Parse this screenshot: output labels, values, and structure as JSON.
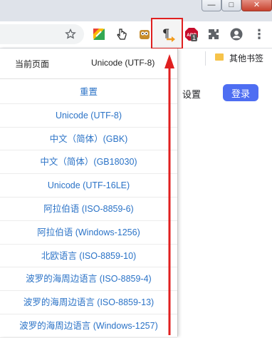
{
  "window": {
    "min_glyph": "—",
    "max_glyph": "□",
    "close_glyph": "✕"
  },
  "toolbar": {
    "star_icon": "star-icon",
    "extensions": [
      {
        "name": "colorful-extension-icon"
      },
      {
        "name": "cursor-extension-icon"
      },
      {
        "name": "owl-extension-icon"
      },
      {
        "name": "charset-extension-icon",
        "glyph": "¶"
      },
      {
        "name": "abp-extension-icon",
        "glyph": "ABP"
      },
      {
        "name": "puzzle-extensions-icon",
        "glyph": "✚"
      },
      {
        "name": "account-icon"
      },
      {
        "name": "menu-icon",
        "glyph": "⋮"
      }
    ],
    "abp_badge": "1",
    "highlight_color": "#e02020"
  },
  "bookmarks": {
    "other_label": "其他书签"
  },
  "page": {
    "settings_label": "设置",
    "login_label": "登录",
    "login_color": "#4e6ef2"
  },
  "popup": {
    "current_label": "当前页面",
    "current_value": "Unicode (UTF-8)",
    "encodings": [
      "重置",
      "Unicode (UTF-8)",
      "中文（简体）(GBK)",
      "中文（简体）(GB18030)",
      "Unicode (UTF-16LE)",
      "阿拉伯语 (ISO-8859-6)",
      "阿拉伯语 (Windows-1256)",
      "北欧语言 (ISO-8859-10)",
      "波罗的海周边语言 (ISO-8859-4)",
      "波罗的海周边语言 (ISO-8859-13)",
      "波罗的海周边语言 (Windows-1257)"
    ],
    "link_color": "#2b73c7"
  },
  "annotation": {
    "arrow_color": "#e02020"
  }
}
